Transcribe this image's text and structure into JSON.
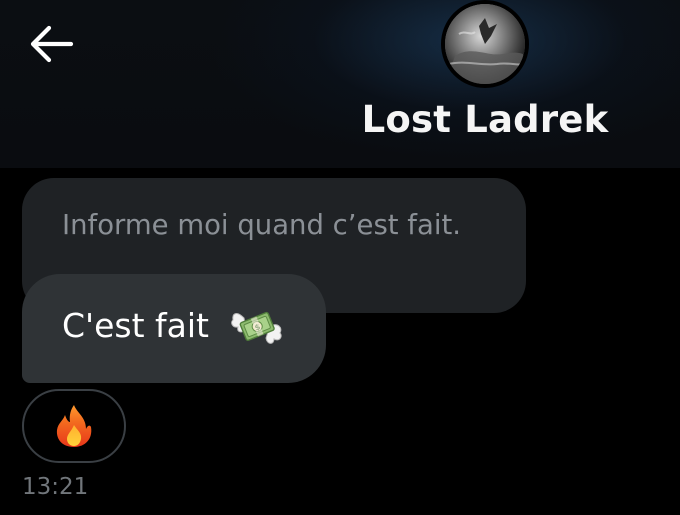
{
  "header": {
    "back_icon": "arrow-left-icon",
    "contact_name": "Lost Ladrek",
    "avatar_icon": "profile-avatar"
  },
  "conversation": {
    "quoted_message": "Informe moi quand c’est fait.",
    "message": {
      "text": "C'est fait",
      "emoji_icon": "money-with-wings-icon"
    },
    "reaction": {
      "emoji_icon": "fire-icon"
    },
    "timestamp": "13:21"
  },
  "colors": {
    "background": "#000000",
    "bubble_sent": "#2f3336",
    "bubble_quoted": "#1f2225",
    "text_primary": "#ffffff",
    "text_secondary": "#71767b"
  }
}
